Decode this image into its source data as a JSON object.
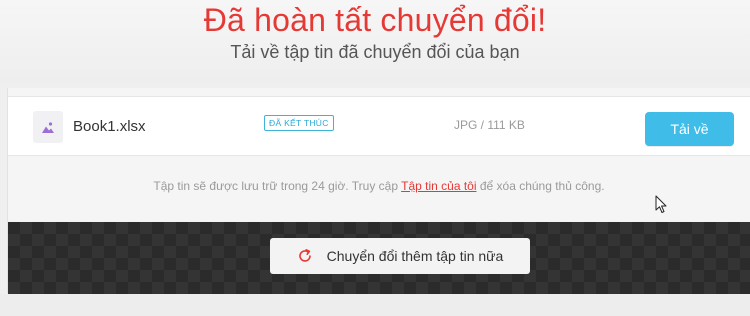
{
  "header": {
    "title": "Đã hoàn tất chuyển đổi!",
    "subtitle": "Tải về tập tin đã chuyển đổi của bạn"
  },
  "file": {
    "name": "Book1.xlsx",
    "status": "ĐÃ KẾT THÚC",
    "meta": "JPG / 111 KB",
    "icon": "image-file-icon",
    "download_label": "Tải về"
  },
  "retention": {
    "before": "Tập tin sẽ được lưu trữ trong 24 giờ. Truy cập ",
    "link": "Tập tin của tôi",
    "after": " để xóa chúng thủ công."
  },
  "convert_more": {
    "label": "Chuyển đổi thêm tập tin nữa",
    "icon": "refresh-icon"
  },
  "colors": {
    "accent_red": "#e53935",
    "accent_blue": "#3fbde8",
    "dark_bar": "#2b2b2b"
  }
}
